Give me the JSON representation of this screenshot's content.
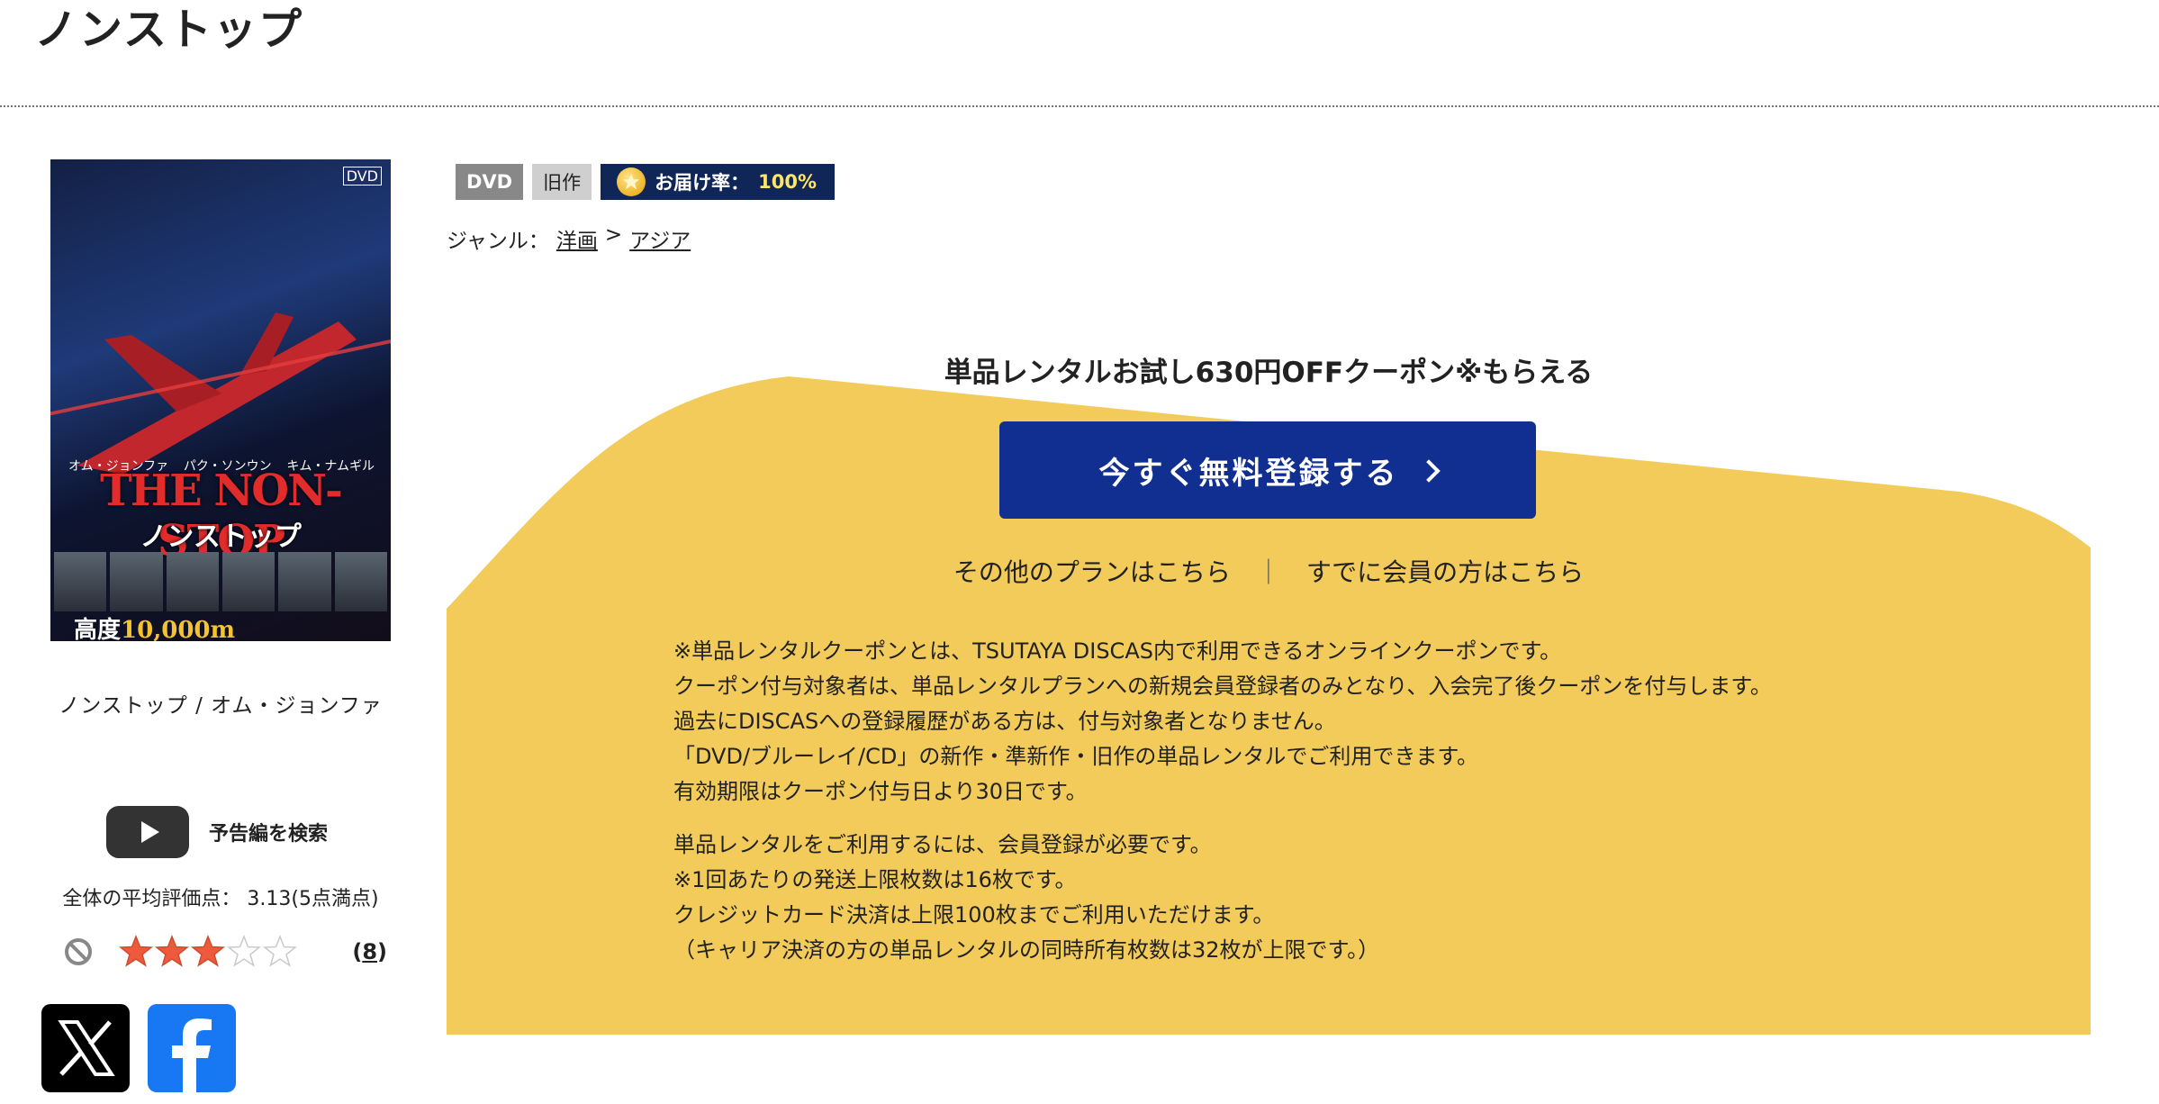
{
  "page": {
    "title": "ノンストップ"
  },
  "jacket": {
    "dvd_mark": "DVD",
    "cast": [
      "オム・ジョンファ",
      "パク・ソンウン",
      "キム・ナムギル"
    ],
    "title_en": "THE NON-STOP",
    "title_jp": "ノンストップ",
    "tagline_prefix": "高度",
    "tagline_highlight": "10,000m"
  },
  "item": {
    "caption": "ノンストップ / オム・ジョンファ"
  },
  "trailer": {
    "label": "予告編を検索"
  },
  "rating": {
    "label": "全体の平均評価点：  3.13(5点満点)",
    "value": 3.13,
    "max": 5,
    "filled_stars": 3,
    "review_count": "8",
    "star_color": "#ef5a3c"
  },
  "badges": {
    "format": "DVD",
    "status": "旧作",
    "delivery_label": "お届け率：",
    "delivery_rate": "100%"
  },
  "genre": {
    "label": "ジャンル：",
    "links": [
      "洋画",
      "アジア"
    ],
    "sep": ">"
  },
  "promo": {
    "headline": "単品レンタルお試し630円OFFクーポン※もらえる",
    "register_label": "今すぐ無料登録する",
    "other_plans": "その他のプランはこちら",
    "link_sep": "｜",
    "members": "すでに会員の方はこちら",
    "bg_color": "#f2cb5a",
    "button_color": "#102f91"
  },
  "notes": {
    "block1": [
      "※単品レンタルクーポンとは、TSUTAYA DISCAS内で利用できるオンラインクーポンです。",
      "クーポン付与対象者は、単品レンタルプランへの新規会員登録者のみとなり、入会完了後クーポンを付与します。",
      "過去にDISCASへの登録履歴がある方は、付与対象者となりません。",
      "「DVD/ブルーレイ/CD」の新作・準新作・旧作の単品レンタルでご利用できます。",
      "有効期限はクーポン付与日より30日です。"
    ],
    "block2": [
      "単品レンタルをご利用するには、会員登録が必要です。",
      "※1回あたりの発送上限枚数は16枚です。",
      "クレジットカード決済は上限100枚までご利用いただけます。",
      "（キャリア決済の方の単品レンタルの同時所有枚数は32枚が上限です。）"
    ]
  },
  "sns": {
    "x_icon": "x-logo-icon",
    "facebook_icon": "facebook-logo-icon"
  }
}
